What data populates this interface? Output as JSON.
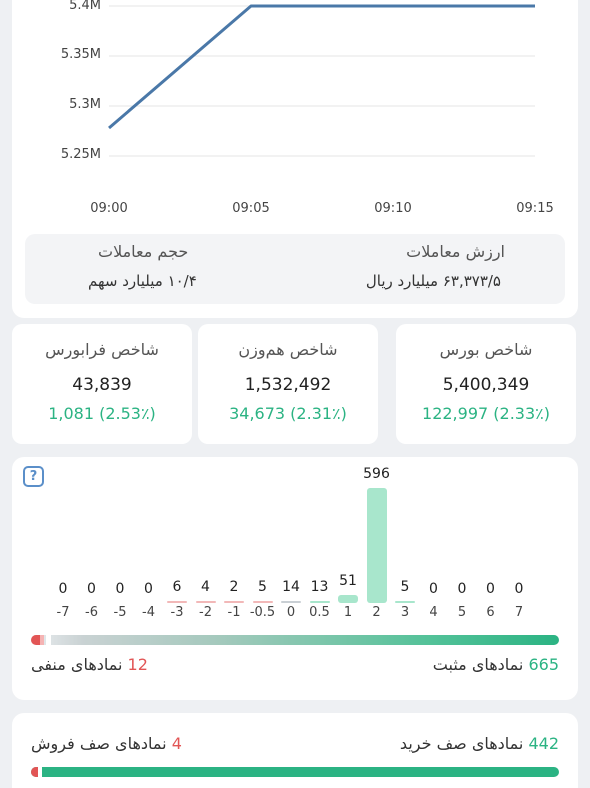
{
  "chart_data": {
    "type": "line",
    "x": [
      "09:00",
      "09:05",
      "09:10",
      "09:15"
    ],
    "series": [
      {
        "values": [
          5278000,
          5400000,
          5400000,
          5400000
        ]
      }
    ],
    "y_ticks": [
      "5.4M",
      "5.35M",
      "5.3M",
      "5.25M"
    ],
    "x_ticks": [
      "09:00",
      "09:05",
      "09:10",
      "09:15"
    ],
    "ylim": [
      5250000,
      5400000
    ],
    "grid": true,
    "line_color": "#4a78a8"
  },
  "summary": {
    "trade_value_title": "ارزش معاملات",
    "trade_value": "۶۳,۳۷۳/۵ میلیارد ریال",
    "trade_volume_title": "حجم معاملات",
    "trade_volume": "۱۰/۴ میلیارد سهم"
  },
  "indices": [
    {
      "title": "شاخص بورس",
      "value": "5,400,349",
      "change": "122,997 (2.33٪)"
    },
    {
      "title": "شاخص هم‌وزن",
      "value": "1,532,492",
      "change": "34,673 (2.31٪)"
    },
    {
      "title": "شاخص فرابورس",
      "value": "43,839",
      "change": "1,081 (2.53٪)"
    }
  ],
  "distribution": {
    "help_icon": "question-mark-icon",
    "buckets": [
      {
        "tick": "-7",
        "count": "0"
      },
      {
        "tick": "-6",
        "count": "0"
      },
      {
        "tick": "-5",
        "count": "0"
      },
      {
        "tick": "-4",
        "count": "0"
      },
      {
        "tick": "-3",
        "count": "6"
      },
      {
        "tick": "-2",
        "count": "4"
      },
      {
        "tick": "-1",
        "count": "2"
      },
      {
        "tick": "-0.5",
        "count": "5"
      },
      {
        "tick": "0",
        "count": "14"
      },
      {
        "tick": "0.5",
        "count": "13"
      },
      {
        "tick": "1",
        "count": "51"
      },
      {
        "tick": "2",
        "count": "596"
      },
      {
        "tick": "3",
        "count": "5"
      },
      {
        "tick": "4",
        "count": "0"
      },
      {
        "tick": "5",
        "count": "0"
      },
      {
        "tick": "6",
        "count": "0"
      },
      {
        "tick": "7",
        "count": "0"
      }
    ],
    "positive_count": "665",
    "positive_label": "نمادهای مثبت",
    "negative_count": "12",
    "negative_label": "نمادهای منفی"
  },
  "queues": {
    "buy_count": "442",
    "buy_label": "نمادهای صف خرید",
    "sell_count": "4",
    "sell_label": "نمادهای صف فروش"
  },
  "colors": {
    "positive": "#2bb383",
    "negative": "#e25555",
    "positive_bar": "#a8e6cc"
  }
}
